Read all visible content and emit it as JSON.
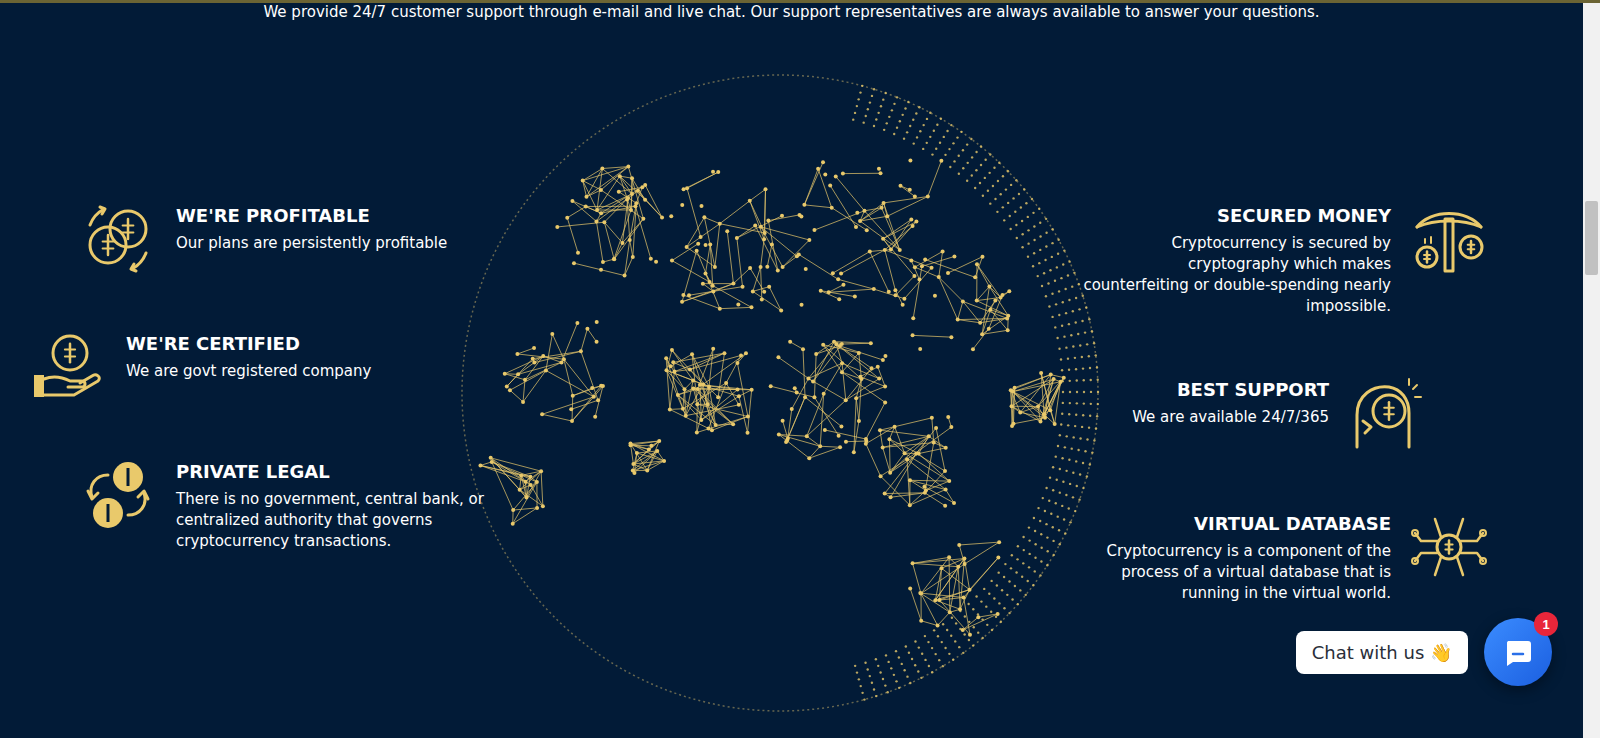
{
  "intro": "We provide 24/7 customer support through e-mail and live chat. Our support representatives are always available to answer your questions.",
  "features_left": [
    {
      "title": "WE'RE PROFITABLE",
      "text": "Our plans are persistently profitable",
      "icon": "coins"
    },
    {
      "title": "WE'RE CERTIFIED",
      "text": "We are govt registered company",
      "icon": "hand"
    },
    {
      "title": "PRIVATE LEGAL",
      "text": "There is no government, central bank, or centralized authority that governs cryptocurrency transactions.",
      "icon": "exchange"
    }
  ],
  "features_right": [
    {
      "title": "SECURED MONEY",
      "text": "Cryptocurrency is secured by cryptography which makes counterfeiting or double-spending nearly impossible.",
      "icon": "pickaxe"
    },
    {
      "title": "BEST SUPPORT",
      "text": "We are available 24/7/365",
      "icon": "head"
    },
    {
      "title": "VIRTUAL DATABASE",
      "text": "Cryptocurrency is a component of the process of a virtual database that is running in the virtual world.",
      "icon": "circuit"
    }
  ],
  "chat": {
    "label": "Chat with us 👋",
    "badge": "1"
  }
}
